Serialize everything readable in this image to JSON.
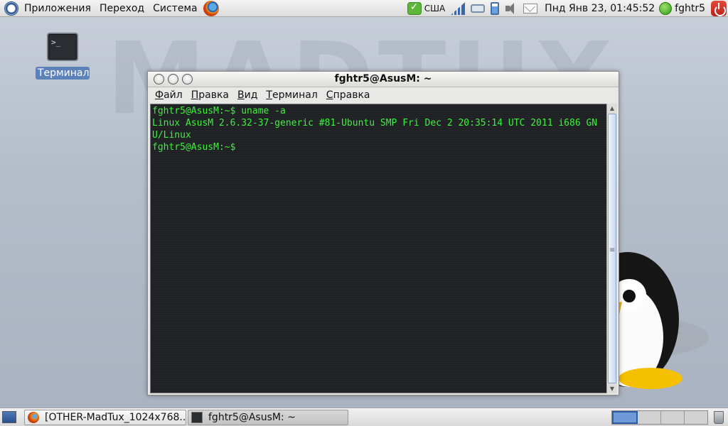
{
  "top_panel": {
    "menu": [
      "Приложения",
      "Переход",
      "Система"
    ],
    "keyboard_layout": "США",
    "clock": "Пнд Янв 23, 01:45:52",
    "user": "fghtr5",
    "icons": [
      "ubuntu-logo",
      "firefox-icon",
      "vpn-check-icon",
      "signal-icon",
      "network-icon",
      "battery-icon",
      "volume-icon",
      "mail-icon",
      "user-status-icon",
      "power-icon"
    ]
  },
  "desktop": {
    "icon_label": "Терминал",
    "icon_glyph": ">_"
  },
  "window": {
    "title": "fghtr5@AsusM: ~",
    "menu": [
      "Файл",
      "Правка",
      "Вид",
      "Терминал",
      "Справка"
    ],
    "terminal_lines": [
      "fghtr5@AsusM:~$ uname -a",
      "Linux AsusM 2.6.32-37-generic #81-Ubuntu SMP Fri Dec 2 20:35:14 UTC 2011 i686 GN",
      "U/Linux",
      "fghtr5@AsusM:~$"
    ],
    "text_color": "#3df23d",
    "background_color": "#1f2124"
  },
  "bottom_panel": {
    "tasks": [
      "[OTHER-MadTux_1024x768....",
      "fghtr5@AsusM: ~"
    ],
    "workspaces_count": 4,
    "active_workspace": 1
  }
}
